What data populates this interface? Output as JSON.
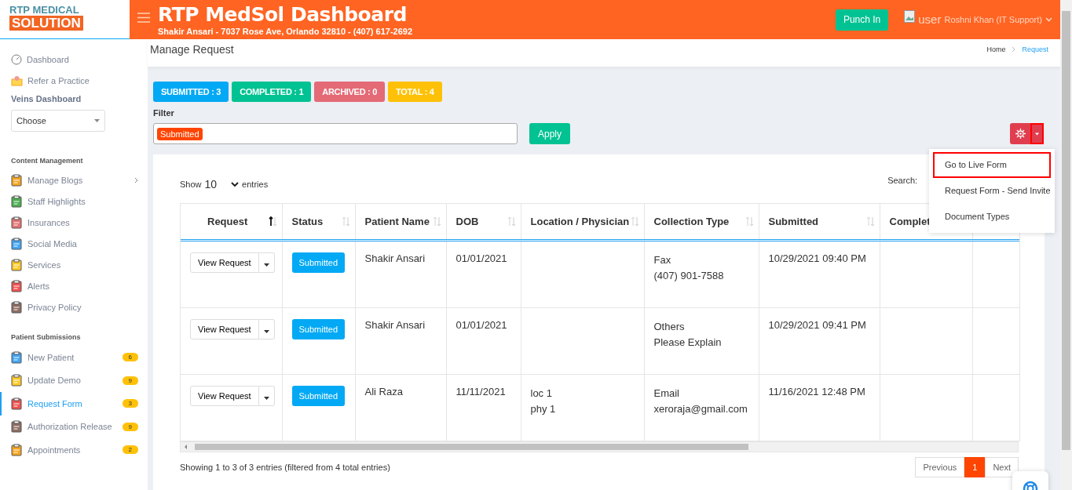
{
  "logo": {
    "line_1": "RTP MEDICAL",
    "line_2": "SOLUTION"
  },
  "header": {
    "title": "RTP MedSol Dashboard",
    "subtitle": "Shakir Ansari - 7037 Rose Ave, Orlando 32810 - (407) 617-2692",
    "punch_button": "Punch In",
    "user_image_alt": "user",
    "user_name": "Roshni Khan (IT Support)"
  },
  "sidebar": {
    "top_items": [
      {
        "label": "Dashboard",
        "selected": false
      },
      {
        "label": "Refer a Practice",
        "selected": false
      }
    ],
    "veins_label": "Veins Dashboard",
    "veins_select": "Choose",
    "sections": [
      {
        "title": "Content Management",
        "items": [
          {
            "label": "Manage Blogs",
            "selected": false,
            "submenu": true
          },
          {
            "label": "Staff Highlights",
            "selected": false,
            "submenu": false
          },
          {
            "label": "Insurances",
            "selected": false,
            "submenu": false
          },
          {
            "label": "Social Media",
            "selected": false,
            "submenu": false
          },
          {
            "label": "Services",
            "selected": false,
            "submenu": false
          },
          {
            "label": "Alerts",
            "selected": false,
            "submenu": false
          },
          {
            "label": "Privacy Policy",
            "selected": false,
            "submenu": false
          }
        ]
      },
      {
        "title": "Patient Submissions",
        "items": [
          {
            "label": "New Patient",
            "selected": false,
            "submenu": false,
            "badge": "6"
          },
          {
            "label": "Update Demo",
            "selected": false,
            "submenu": false,
            "badge": "9"
          },
          {
            "label": "Request Form",
            "selected": true,
            "submenu": false,
            "badge": "3"
          },
          {
            "label": "Authorization Release",
            "selected": false,
            "submenu": false,
            "badge": "9"
          },
          {
            "label": "Appointments",
            "selected": false,
            "submenu": false,
            "badge": "2"
          }
        ]
      }
    ]
  },
  "page": {
    "title": "Manage Request",
    "breadcrumbs": [
      {
        "label": "Home",
        "selected": false
      },
      {
        "label": "Request",
        "selected": true
      }
    ]
  },
  "counters": [
    {
      "label": "SUBMITTED : 3",
      "color": "#03a9f4"
    },
    {
      "label": "COMPLETED : 1",
      "color": "#00c292"
    },
    {
      "label": "ARCHIVED : 0",
      "color": "#e46a76"
    },
    {
      "label": "TOTAL : 4",
      "color": "#fec107"
    }
  ],
  "filter": {
    "label": "Filter",
    "tags": [
      "Submitted"
    ],
    "apply_button": "Apply"
  },
  "settings_menu": {
    "caret_highlighted": true,
    "items": [
      {
        "label": "Go to Live Form",
        "highlighted": true
      },
      {
        "label": "Request Form - Send Invite",
        "highlighted": false
      },
      {
        "label": "Document Types",
        "highlighted": false
      }
    ]
  },
  "table": {
    "show_label": "Show",
    "entries_value": "10",
    "entries_label": "entries",
    "search_label": "Search:",
    "columns": [
      {
        "label": "Request",
        "sorted": true
      },
      {
        "label": "Status",
        "sorted": false
      },
      {
        "label": "Patient Name",
        "sorted": false
      },
      {
        "label": "DOB",
        "sorted": false
      },
      {
        "label": "Location / Physician",
        "sorted": false
      },
      {
        "label": "Collection Type",
        "sorted": false
      },
      {
        "label": "Submitted",
        "sorted": false
      },
      {
        "label": "Complet"
      }
    ],
    "rows": [
      {
        "action": "View Request",
        "status": "Submitted",
        "patient_name": "Shakir Ansari",
        "dob": "01/01/2021",
        "location": [],
        "collection_type": [
          "Fax",
          "(407) 901-7588"
        ],
        "submitted": "10/29/2021 09:40 PM"
      },
      {
        "action": "View Request",
        "status": "Submitted",
        "patient_name": "Shakir Ansari",
        "dob": "01/01/2021",
        "location": [],
        "collection_type": [
          "Others",
          "Please Explain"
        ],
        "submitted": "10/29/2021 09:41 PM"
      },
      {
        "action": "View Request",
        "status": "Submitted",
        "patient_name": "Ali Raza",
        "dob": "11/11/2021",
        "location": [
          "loc 1",
          "phy 1"
        ],
        "collection_type": [
          "Email",
          "xeroraja@gmail.com"
        ],
        "submitted": "11/16/2021 12:48 PM"
      }
    ],
    "info": "Showing 1 to 3 of 3 entries (filtered from 4 total entries)",
    "pagination": [
      {
        "label": "Previous",
        "selected": false
      },
      {
        "label": "1",
        "selected": true
      },
      {
        "label": "Next",
        "selected": false
      }
    ]
  }
}
